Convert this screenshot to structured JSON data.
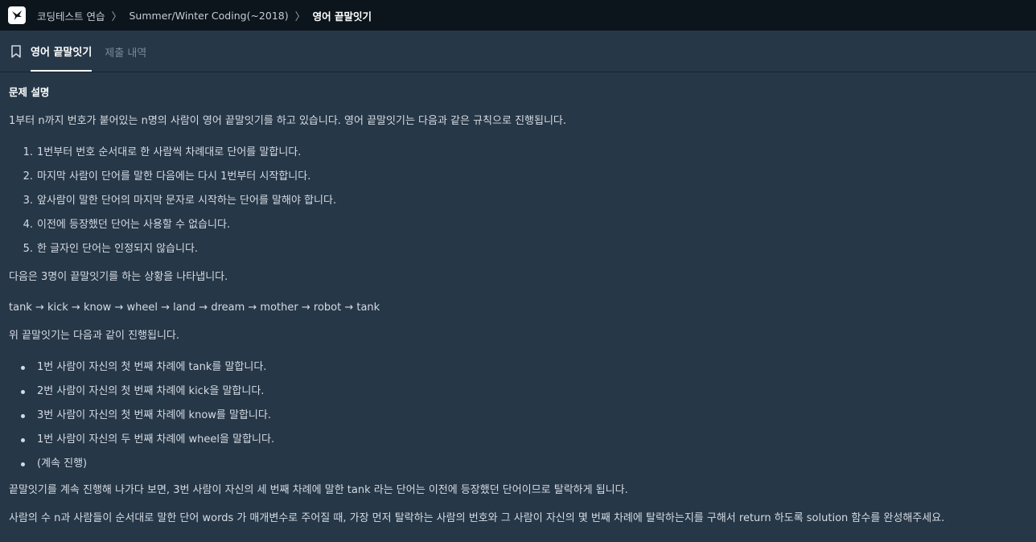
{
  "breadcrumb": {
    "items": [
      "코딩테스트 연습",
      "Summer/Winter Coding(~2018)",
      "영어 끝말잇기"
    ],
    "separator": "〉"
  },
  "tabs": [
    {
      "label": "영어 끝말잇기",
      "active": true
    },
    {
      "label": "제출 내역",
      "active": false
    }
  ],
  "problem": {
    "section_title": "문제 설명",
    "intro": "1부터 n까지 번호가 붙어있는 n명의 사람이 영어 끝말잇기를 하고 있습니다. 영어 끝말잇기는 다음과 같은 규칙으로 진행됩니다.",
    "rules": [
      {
        "num": "1.",
        "text": "1번부터 번호 순서대로 한 사람씩 차례대로 단어를 말합니다."
      },
      {
        "num": "2.",
        "text": "마지막 사람이 단어를 말한 다음에는 다시 1번부터 시작합니다."
      },
      {
        "num": "3.",
        "text": "앞사람이 말한 단어의 마지막 문자로 시작하는 단어를 말해야 합니다."
      },
      {
        "num": "4.",
        "text": "이전에 등장했던 단어는 사용할 수 없습니다."
      },
      {
        "num": "5.",
        "text": "한 글자인 단어는 인정되지 않습니다."
      }
    ],
    "example_intro": "다음은 3명이 끝말잇기를 하는 상황을 나타냅니다.",
    "example_chain": "tank → kick → know → wheel → land → dream → mother → robot → tank",
    "progress_intro": "위 끝말잇기는 다음과 같이 진행됩니다.",
    "progress": [
      "1번 사람이 자신의 첫 번째 차례에 tank를 말합니다.",
      "2번 사람이 자신의 첫 번째 차례에 kick을 말합니다.",
      "3번 사람이 자신의 첫 번째 차례에 know를 말합니다.",
      "1번 사람이 자신의 두 번째 차례에 wheel을 말합니다.",
      "(계속 진행)"
    ],
    "conclusion": "끝말잇기를 계속 진행해 나가다 보면, 3번 사람이 자신의 세 번째 차례에 말한 tank 라는 단어는 이전에 등장했던 단어이므로 탈락하게 됩니다.",
    "task": "사람의 수 n과 사람들이 순서대로 말한 단어 words 가 매개변수로 주어질 때, 가장 먼저 탈락하는 사람의 번호와 그 사람이 자신의 몇 번째 차례에 탈락하는지를 구해서 return 하도록 solution 함수를 완성해주세요."
  },
  "icons": {
    "logo": "programmers-logo",
    "bookmark": "bookmark-icon"
  }
}
